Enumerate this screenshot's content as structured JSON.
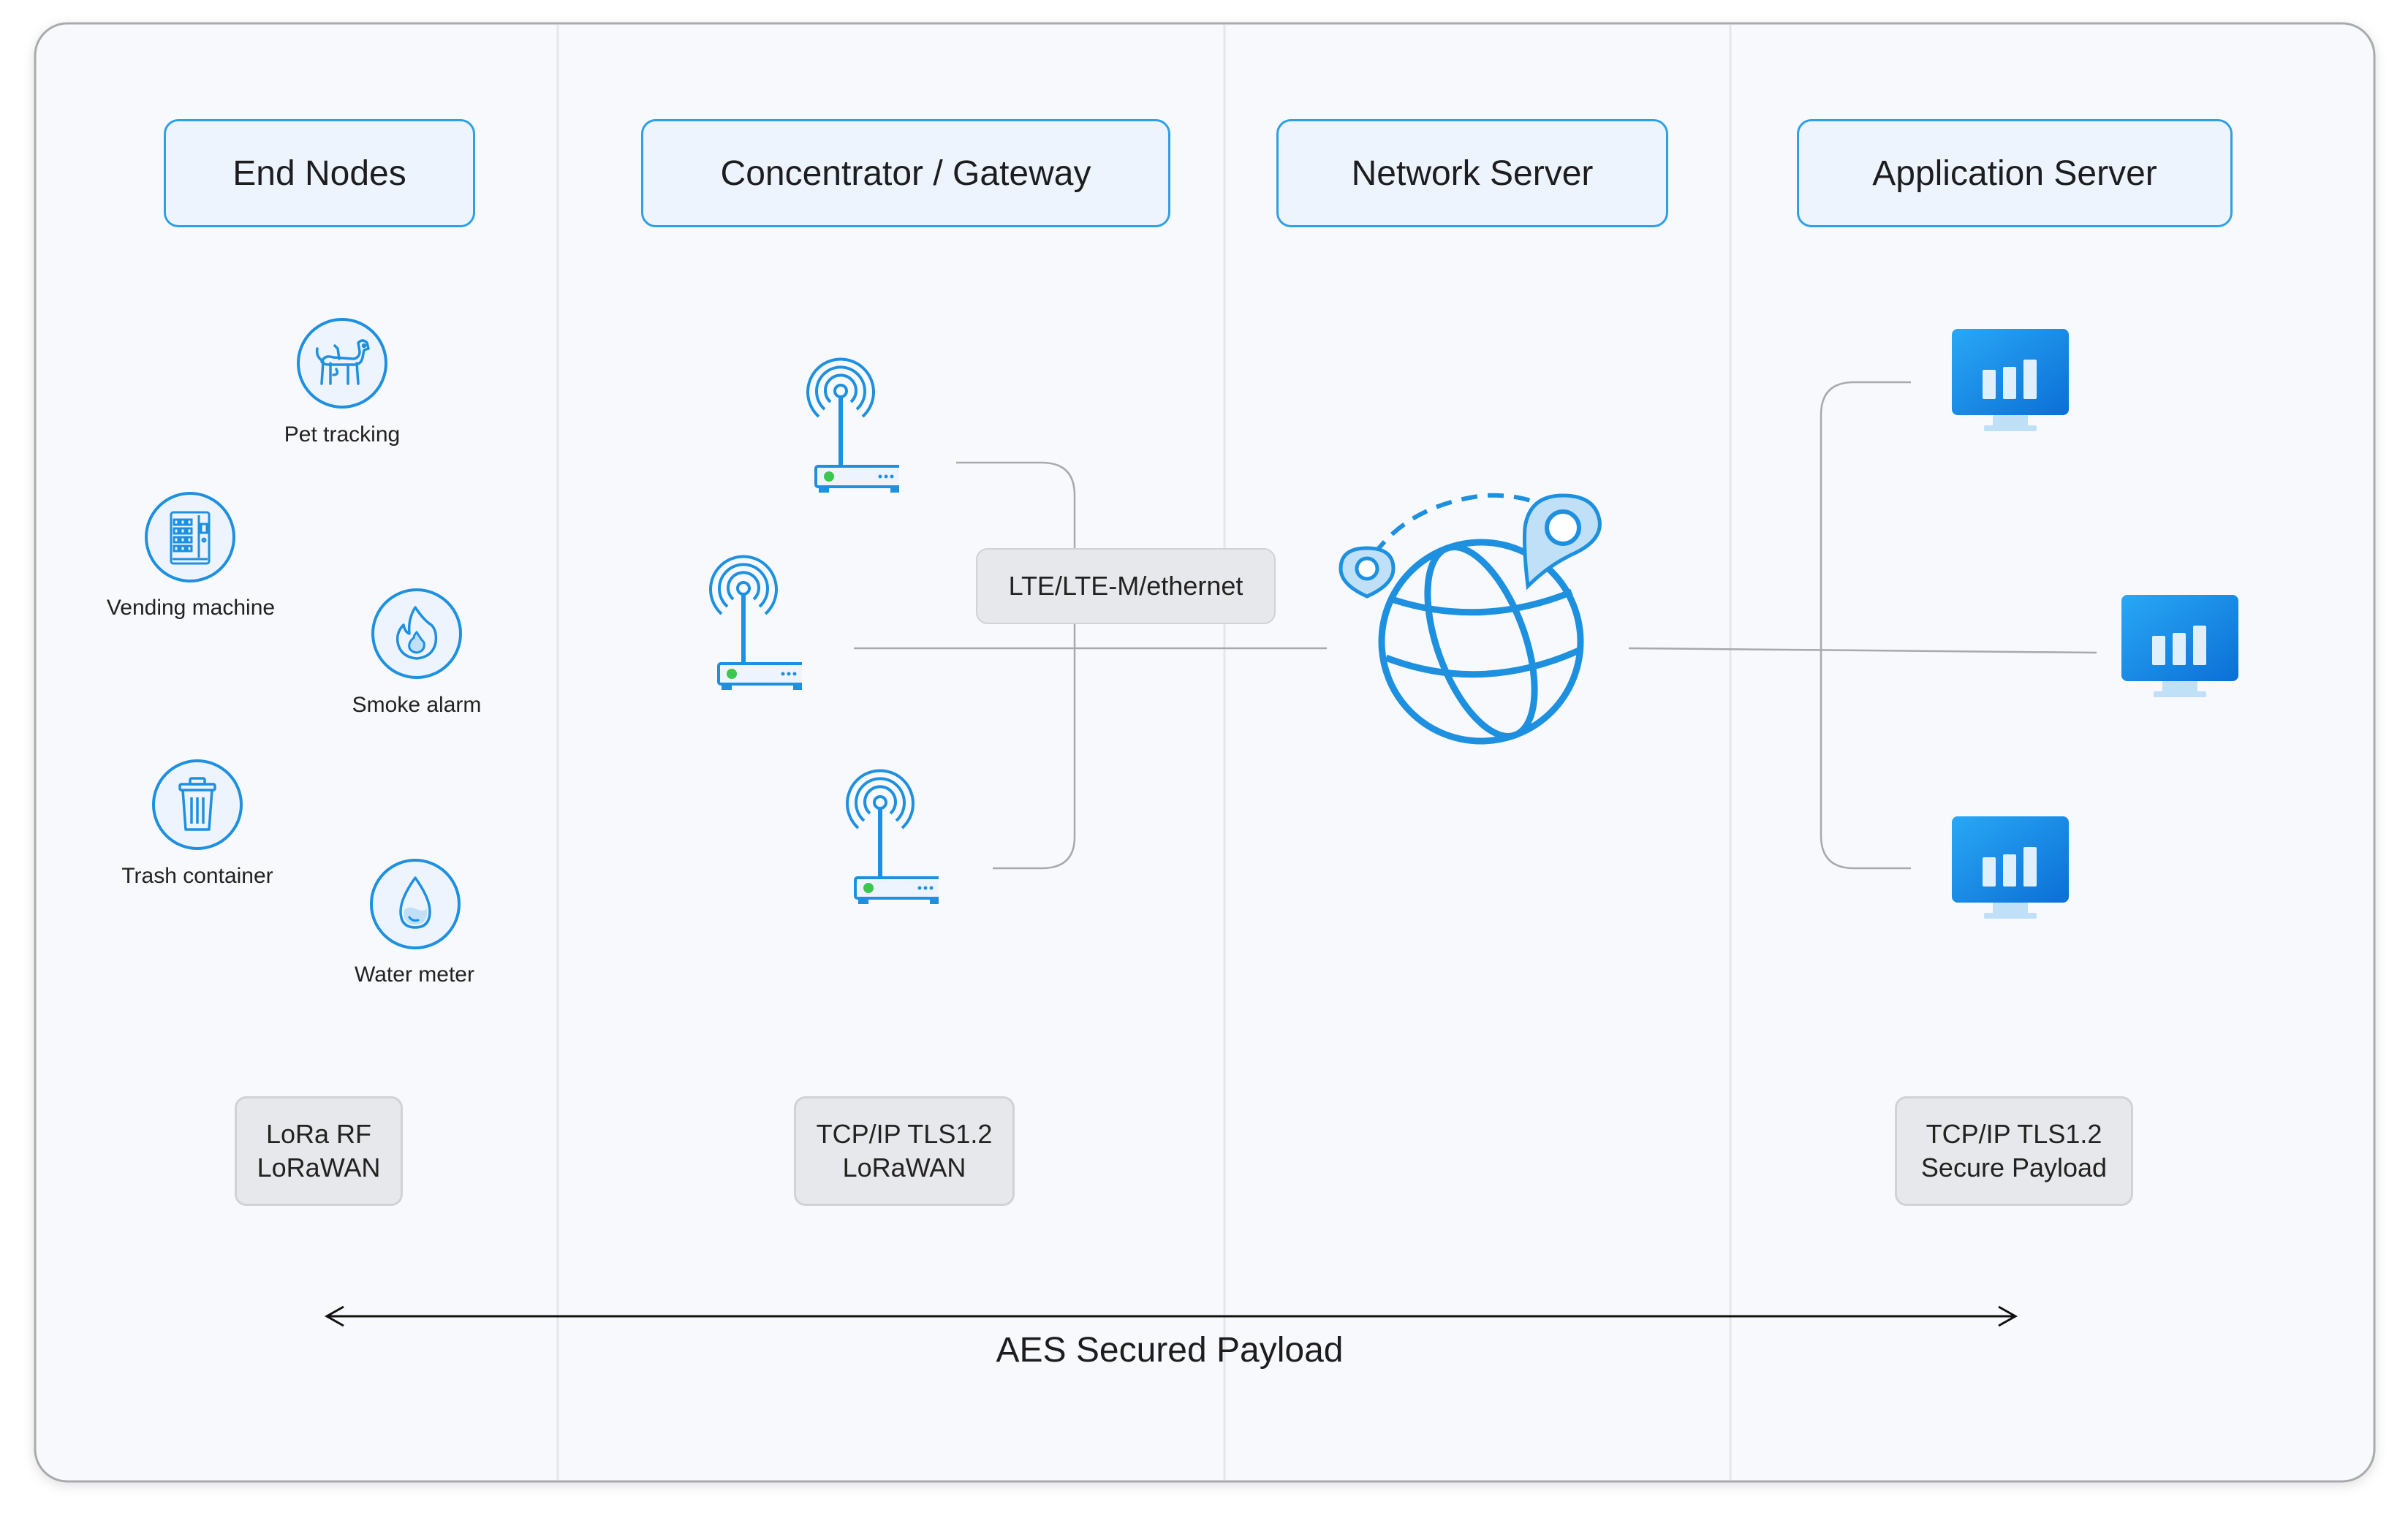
{
  "columns": {
    "end_nodes": "End Nodes",
    "gateway": "Concentrator / Gateway",
    "network_server": "Network Server",
    "application_server": "Application Server"
  },
  "end_nodes": [
    {
      "label": "Pet tracking",
      "icon": "dog-icon"
    },
    {
      "label": "Vending machine",
      "icon": "vending-machine-icon"
    },
    {
      "label": "Smoke alarm",
      "icon": "flame-icon"
    },
    {
      "label": "Trash container",
      "icon": "trash-icon"
    },
    {
      "label": "Water meter",
      "icon": "water-drop-icon"
    }
  ],
  "backhaul_label": "LTE/LTE-M/ethernet",
  "protocols": {
    "end_nodes": [
      "LoRa RF",
      "LoRaWAN"
    ],
    "gateway": [
      "TCP/IP TLS1.2",
      "LoRaWAN"
    ],
    "application": [
      "TCP/IP TLS1.2",
      "Secure Payload"
    ]
  },
  "payload_caption": "AES Secured Payload",
  "icons": {
    "gateway": "gateway-antenna-icon",
    "network": "globe-icon",
    "location_pin": "location-pin-icon",
    "app": "monitor-chart-icon"
  },
  "colors": {
    "accent": "#1e90e0",
    "accent_light": "#bfe0f7",
    "header_fill": "#eef4fd",
    "panel_fill": "#f8f9fc",
    "proto_fill": "#e7e8eb",
    "green_led": "#3cc850"
  }
}
